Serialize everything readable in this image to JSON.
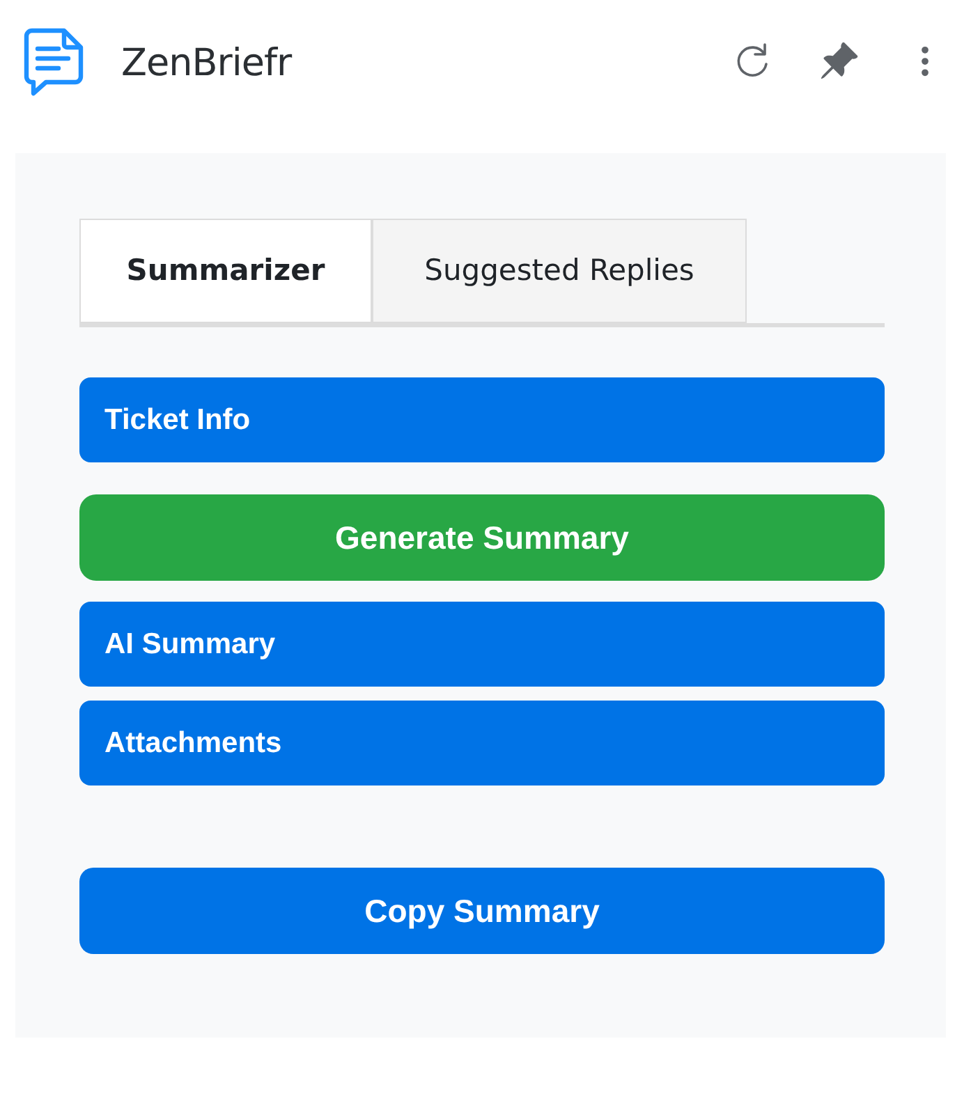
{
  "header": {
    "title": "ZenBriefr"
  },
  "tabs": [
    {
      "label": "Summarizer",
      "selected": true
    },
    {
      "label": "Suggested Replies",
      "selected": false
    }
  ],
  "sections": [
    {
      "kind": "section",
      "label": "Ticket Info"
    },
    {
      "kind": "action",
      "label": "Generate Summary"
    },
    {
      "kind": "section",
      "label": "AI Summary"
    },
    {
      "kind": "section",
      "label": "Attachments"
    }
  ],
  "copy_button": {
    "label": "Copy Summary"
  }
}
